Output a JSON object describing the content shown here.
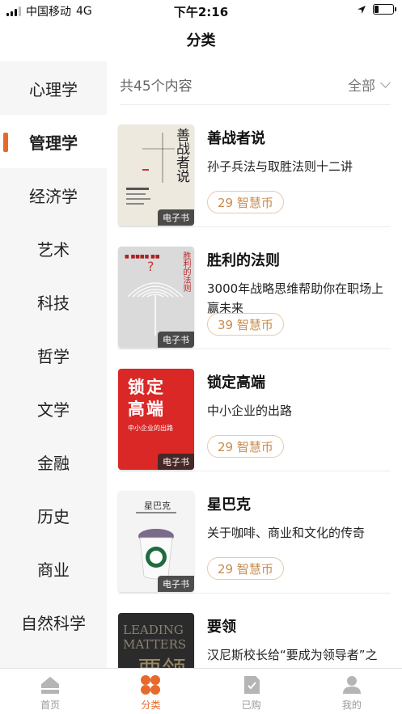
{
  "status_bar": {
    "carrier": "中国移动",
    "network": "4G",
    "time": "下午2:16"
  },
  "header": {
    "title": "分类"
  },
  "sidebar": {
    "items": [
      {
        "label": "心理学",
        "active": false
      },
      {
        "label": "管理学",
        "active": true
      },
      {
        "label": "经济学",
        "active": false
      },
      {
        "label": "艺术",
        "active": false
      },
      {
        "label": "科技",
        "active": false
      },
      {
        "label": "哲学",
        "active": false
      },
      {
        "label": "文学",
        "active": false
      },
      {
        "label": "金融",
        "active": false
      },
      {
        "label": "历史",
        "active": false
      },
      {
        "label": "商业",
        "active": false
      },
      {
        "label": "自然科学",
        "active": false
      }
    ],
    "accent_color": "#e8692c"
  },
  "content": {
    "total_text": "共45个内容",
    "filter_label": "全部",
    "books": [
      {
        "title": "善战者说",
        "description": "孙子兵法与取胜法则十二讲",
        "tag": "电子书",
        "price": "29 智慧币",
        "cover_title": "善战者说"
      },
      {
        "title": "胜利的法则",
        "description": "3000年战略思维帮助你在职场上赢未来",
        "tag": "电子书",
        "price": "39 智慧币",
        "cover_title": "胜利的法则"
      },
      {
        "title": "锁定高端",
        "description": "中小企业的出路",
        "tag": "电子书",
        "price": "29 智慧币",
        "cover_title": "锁定高端",
        "cover_subtitle": "中小企业的出路"
      },
      {
        "title": "星巴克",
        "description": "关于咖啡、商业和文化的传奇",
        "tag": "电子书",
        "price": "29 智慧币",
        "cover_title": "星巴克"
      },
      {
        "title": "要领",
        "description": "汉尼斯校长给“要成为领导者”之",
        "cover_title_en": "LEADING MATTERS",
        "cover_title": "要领"
      }
    ]
  },
  "tabbar": {
    "items": [
      {
        "label": "首页",
        "icon": "home-icon",
        "active": false
      },
      {
        "label": "分类",
        "icon": "category-icon",
        "active": true
      },
      {
        "label": "已购",
        "icon": "purchased-icon",
        "active": false
      },
      {
        "label": "我的",
        "icon": "profile-icon",
        "active": false
      }
    ],
    "active_color": "#e8692c",
    "inactive_color": "#b5b5b5"
  }
}
